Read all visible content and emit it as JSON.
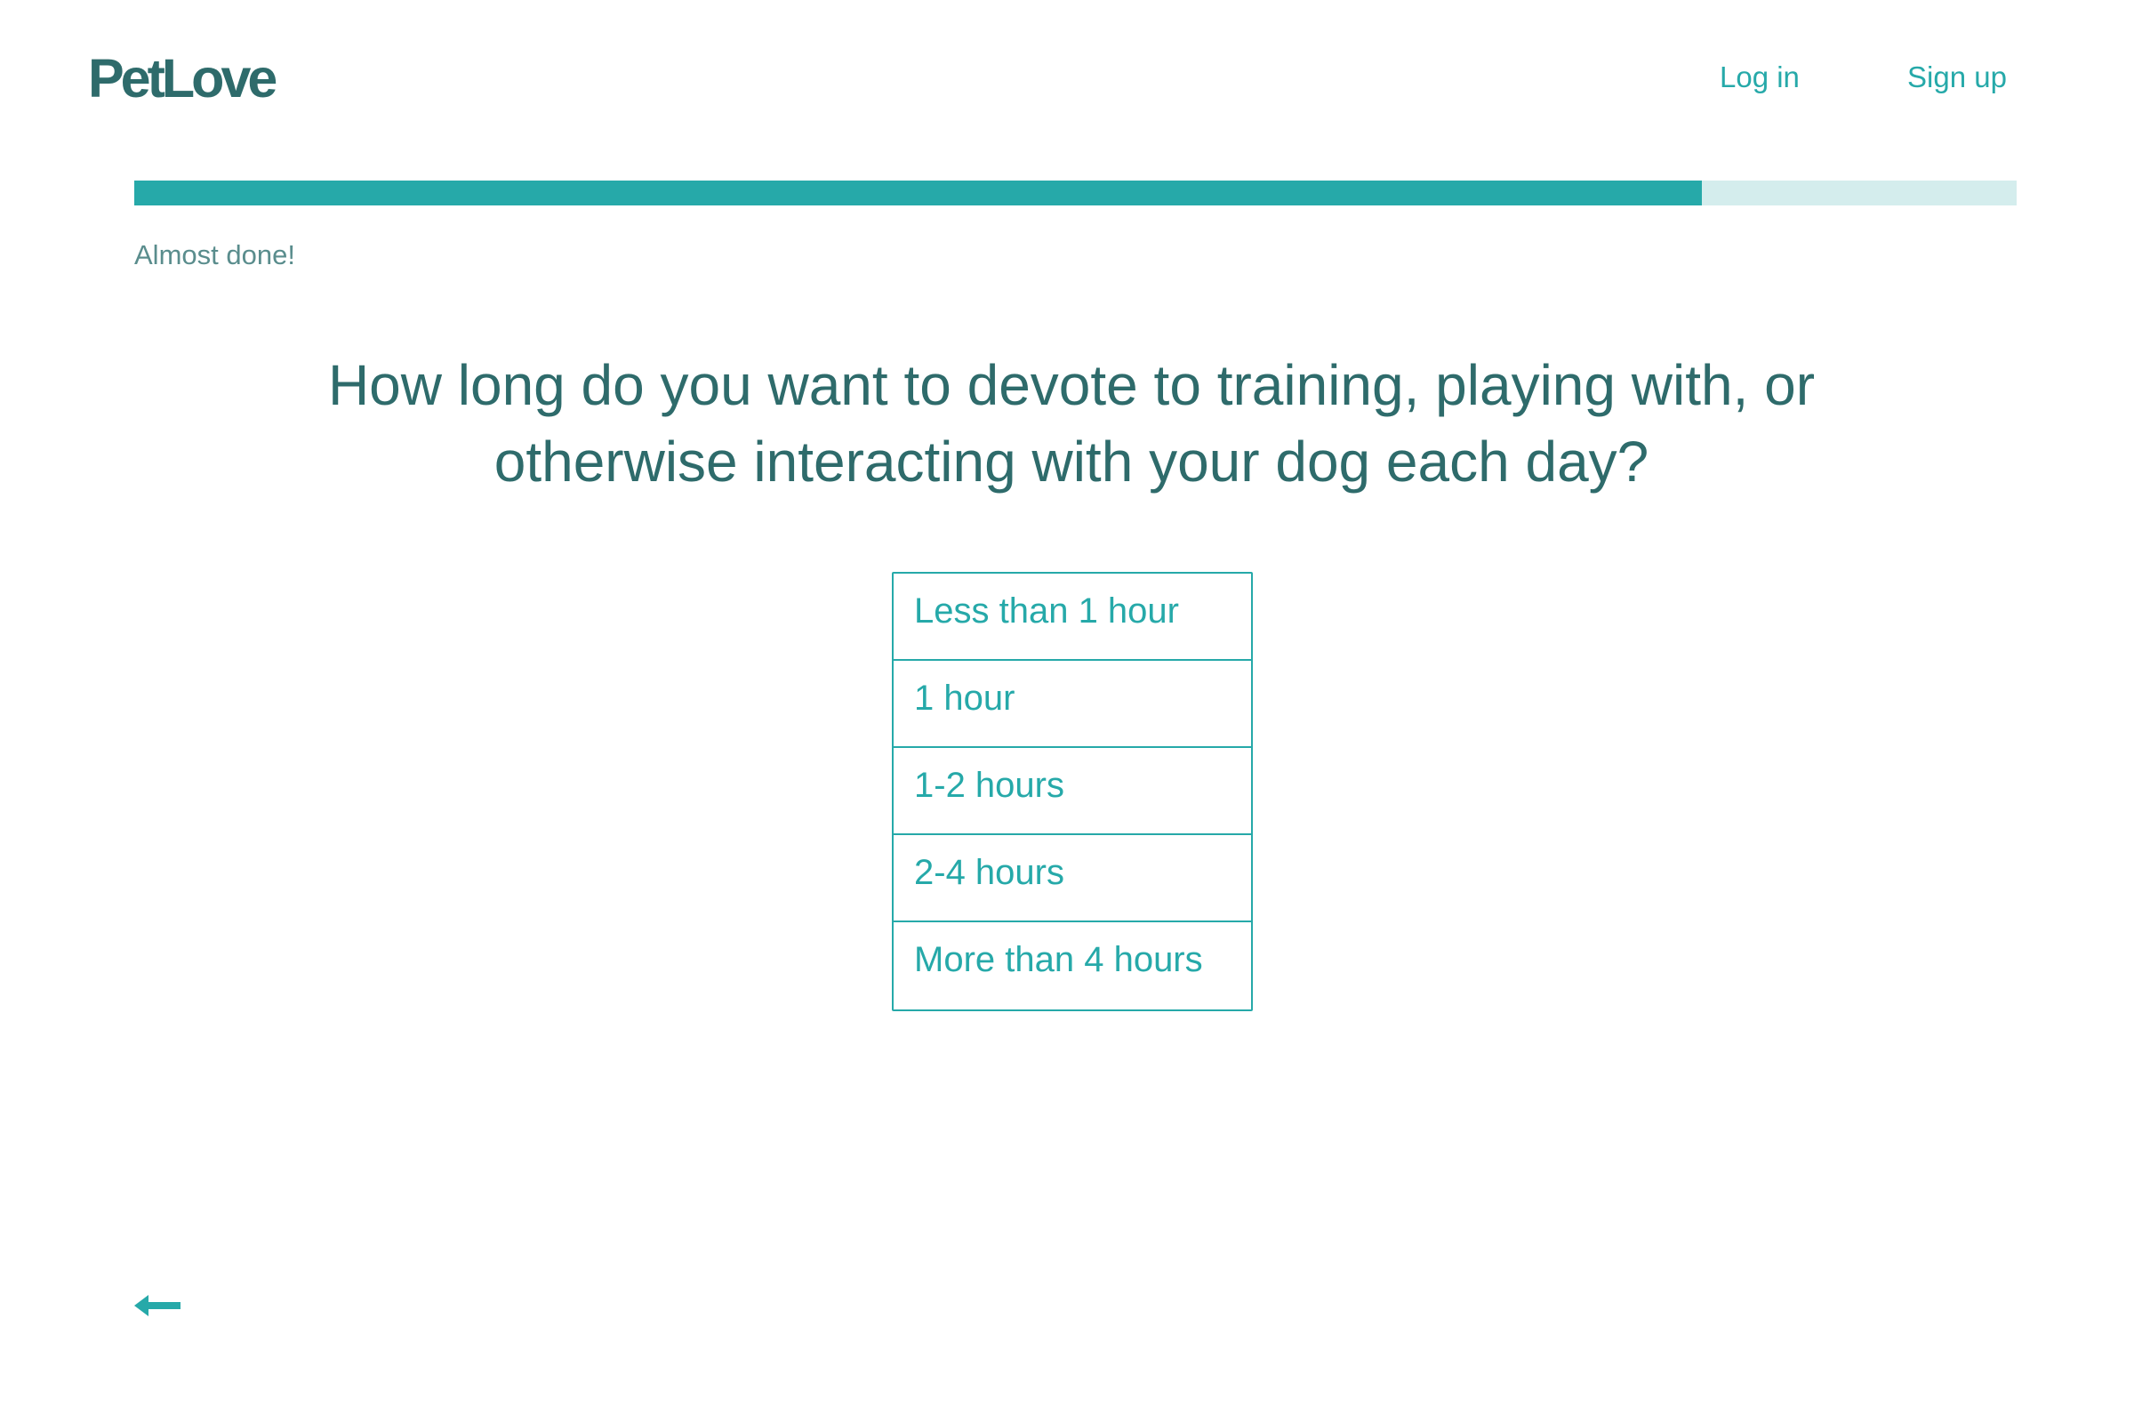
{
  "brand": {
    "logo_text": "PetLove",
    "accent_color": "#26a9a9",
    "dark_color": "#2e6b6b"
  },
  "nav": {
    "login_label": "Log in",
    "signup_label": "Sign up"
  },
  "progress": {
    "fraction": 0.833,
    "caption": "Almost done!"
  },
  "question": {
    "text": "How long do you want to devote to training, playing with, or otherwise interacting with your dog each day?"
  },
  "options": [
    {
      "label": "Less than 1 hour"
    },
    {
      "label": "1 hour"
    },
    {
      "label": "1-2 hours"
    },
    {
      "label": "2-4 hours"
    },
    {
      "label": "More than 4 hours"
    }
  ],
  "footer": {
    "back_icon": "arrow-left-icon"
  }
}
